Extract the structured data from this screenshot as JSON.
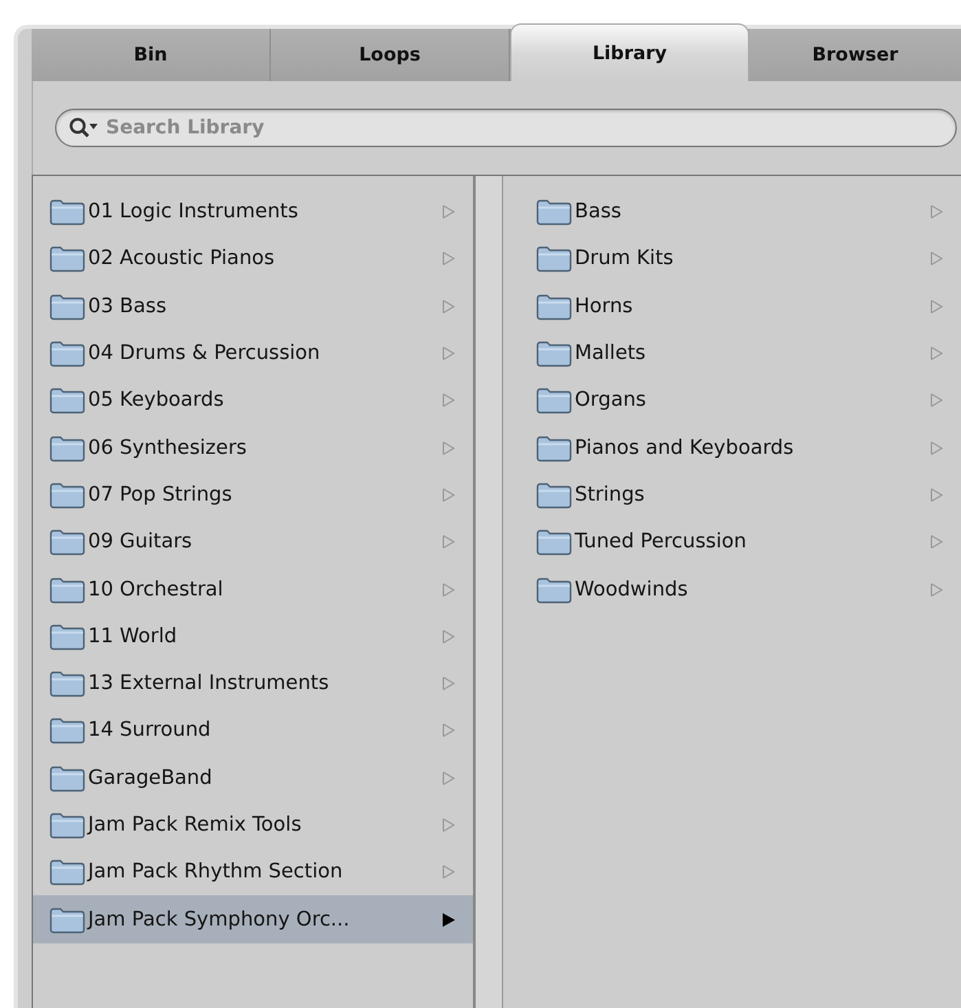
{
  "tabs": [
    {
      "label": "Bin",
      "selected": false
    },
    {
      "label": "Loops",
      "selected": false
    },
    {
      "label": "Library",
      "selected": true
    },
    {
      "label": "Browser",
      "selected": false
    }
  ],
  "search": {
    "placeholder": "Search Library"
  },
  "left_list": [
    {
      "label": "01 Logic Instruments",
      "selected": false
    },
    {
      "label": "02 Acoustic Pianos",
      "selected": false
    },
    {
      "label": "03 Bass",
      "selected": false
    },
    {
      "label": "04 Drums & Percussion",
      "selected": false
    },
    {
      "label": "05 Keyboards",
      "selected": false
    },
    {
      "label": "06 Synthesizers",
      "selected": false
    },
    {
      "label": "07 Pop Strings",
      "selected": false
    },
    {
      "label": "09 Guitars",
      "selected": false
    },
    {
      "label": "10 Orchestral",
      "selected": false
    },
    {
      "label": "11 World",
      "selected": false
    },
    {
      "label": "13 External Instruments",
      "selected": false
    },
    {
      "label": "14 Surround",
      "selected": false
    },
    {
      "label": "GarageBand",
      "selected": false
    },
    {
      "label": "Jam Pack Remix Tools",
      "selected": false
    },
    {
      "label": "Jam Pack Rhythm Section",
      "selected": false
    },
    {
      "label": "Jam Pack Symphony Orc...",
      "selected": true
    }
  ],
  "right_list": [
    {
      "label": "Bass",
      "selected": false
    },
    {
      "label": "Drum Kits",
      "selected": false
    },
    {
      "label": "Horns",
      "selected": false
    },
    {
      "label": "Mallets",
      "selected": false
    },
    {
      "label": "Organs",
      "selected": false
    },
    {
      "label": "Pianos and Keyboards",
      "selected": false
    },
    {
      "label": "Strings",
      "selected": false
    },
    {
      "label": "Tuned Percussion",
      "selected": false
    },
    {
      "label": "Woodwinds",
      "selected": false
    }
  ]
}
